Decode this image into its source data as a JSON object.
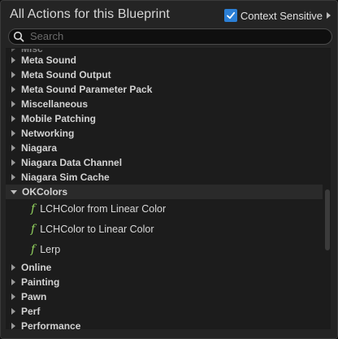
{
  "header": {
    "title": "All Actions for this Blueprint",
    "context_sensitive_label": "Context Sensitive",
    "context_sensitive_checked": true
  },
  "search": {
    "placeholder": "Search",
    "value": ""
  },
  "list": {
    "partial_top_label": "Misc",
    "items": [
      {
        "type": "category",
        "label": "Meta Sound",
        "expanded": false
      },
      {
        "type": "category",
        "label": "Meta Sound Output",
        "expanded": false
      },
      {
        "type": "category",
        "label": "Meta Sound Parameter Pack",
        "expanded": false
      },
      {
        "type": "category",
        "label": "Miscellaneous",
        "expanded": false
      },
      {
        "type": "category",
        "label": "Mobile Patching",
        "expanded": false
      },
      {
        "type": "category",
        "label": "Networking",
        "expanded": false
      },
      {
        "type": "category",
        "label": "Niagara",
        "expanded": false
      },
      {
        "type": "category",
        "label": "Niagara Data Channel",
        "expanded": false
      },
      {
        "type": "category",
        "label": "Niagara Sim Cache",
        "expanded": false
      },
      {
        "type": "category",
        "label": "OKColors",
        "expanded": true
      },
      {
        "type": "function",
        "label": "LCHColor from Linear Color",
        "icon": "function-icon"
      },
      {
        "type": "function",
        "label": "LCHColor to Linear Color",
        "icon": "function-icon"
      },
      {
        "type": "function",
        "label": "Lerp",
        "icon": "function-icon"
      },
      {
        "type": "category",
        "label": "Online",
        "expanded": false
      },
      {
        "type": "category",
        "label": "Painting",
        "expanded": false
      },
      {
        "type": "category",
        "label": "Pawn",
        "expanded": false
      },
      {
        "type": "category",
        "label": "Perf",
        "expanded": false
      },
      {
        "type": "category",
        "label": "Performance",
        "expanded": false
      }
    ]
  },
  "colors": {
    "accent": "#2b7fd6",
    "function_icon": "#93d45f",
    "panel_bg": "#242424",
    "list_bg": "#1c1c1c"
  }
}
